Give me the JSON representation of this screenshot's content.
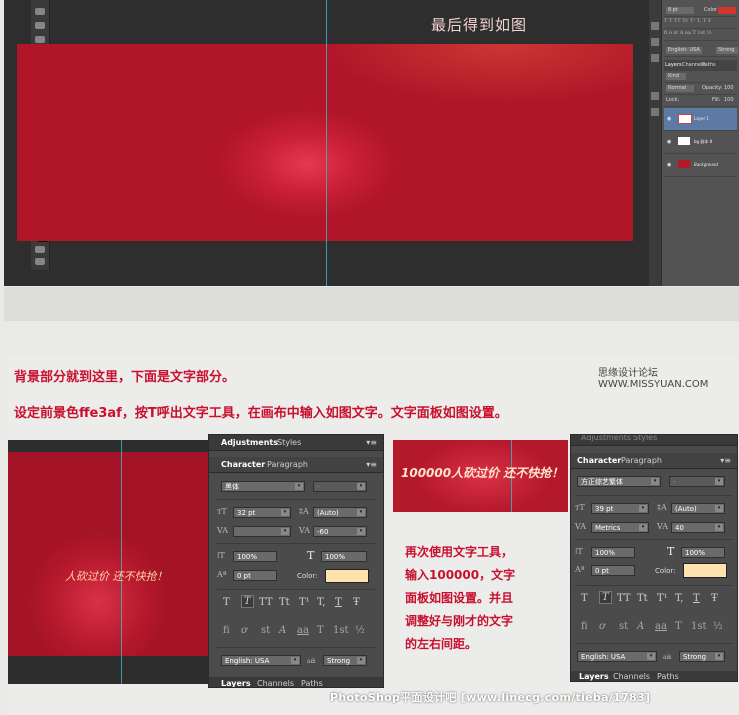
{
  "top_shot": {
    "note": "最后得到如图",
    "right_panel": {
      "char_field": "8 pt",
      "color_label": "Color",
      "language": "English: USA",
      "aa": "Strong",
      "tabs": [
        "Layers",
        "Channels",
        "Paths"
      ],
      "kind": "Kind",
      "blend": "Normal",
      "opacity_label": "Opacity:",
      "opacity_value": "100",
      "lock_label": "Lock:",
      "fill_label": "Fill:",
      "fill_value": "100",
      "layers": [
        "Layer 1",
        "bg 副本 8",
        "Background"
      ]
    }
  },
  "instructions": {
    "line1": "背景部分就到这里，下面是文字部分。",
    "line2": "设定前景色ffe3af，按T呼出文字工具，在画布中输入如图文字。文字面板如图设置。"
  },
  "logo": "思缘设计论坛 WWW.MISSYUAN.COM",
  "canvas_left_text": "人砍过价 还不快抢！",
  "canvas_right_text": "100000人砍过价 还不快抢！",
  "panel_left": {
    "top_tabs": [
      "Adjustments",
      "Styles"
    ],
    "tabs": [
      "Character",
      "Paragraph"
    ],
    "font_family": "黑体",
    "font_style": "-",
    "size": "32 pt",
    "leading": "(Auto)",
    "kerning": "",
    "tracking": "-60",
    "v_scale": "100%",
    "h_scale": "100%",
    "baseline": "0 pt",
    "color_label": "Color:",
    "color": "#ffe3af",
    "language": "English: USA",
    "aa_label": "a",
    "aa": "Strong",
    "bottom_tabs": [
      "Layers",
      "Channels",
      "Paths"
    ]
  },
  "panel_right": {
    "top_tabs": [
      "Adjustments",
      "Styles"
    ],
    "tabs": [
      "Character",
      "Paragraph"
    ],
    "font_family": "方正综艺繁体",
    "font_style": "-",
    "size": "39 pt",
    "leading": "(Auto)",
    "kerning": "Metrics",
    "tracking": "40",
    "v_scale": "100%",
    "h_scale": "100%",
    "baseline": "0 pt",
    "color_label": "Color:",
    "color": "#ffe3af",
    "language": "English: USA",
    "aa_label": "a",
    "aa": "Strong",
    "bottom_tabs": [
      "Layers",
      "Channels",
      "Paths"
    ]
  },
  "note_right": [
    "再次使用文字工具，",
    "输入100000，文字",
    "面板如图设置。并且",
    "调整好与刚才的文字",
    "的左右间距。"
  ],
  "typo_glyphs": [
    "T",
    "T",
    "TT",
    "Tt",
    "T¹",
    "T,",
    "T",
    "Ŧ"
  ],
  "opentype_glyphs": [
    "fi",
    "ơ",
    "st",
    "A",
    "aa",
    "T",
    "1st",
    "½"
  ],
  "footer": "PhotoShop平面设计吧 [www.linecg.com/tieba/1783]"
}
